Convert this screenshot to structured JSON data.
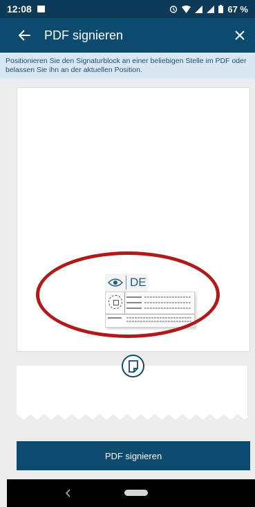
{
  "status_bar": {
    "time": "12:08",
    "battery_percent": "67 %",
    "icons": [
      "image-icon",
      "alarm-icon",
      "wifi-icon",
      "signal-icon",
      "signal-icon",
      "battery-icon"
    ]
  },
  "app_bar": {
    "title": "PDF signieren",
    "back_icon": "arrow-left-icon",
    "close_icon": "close-icon"
  },
  "info": {
    "text": "Positionieren Sie den Signaturblock an einer beliebigen Stelle im PDF oder belassen Sie ihn an der aktuellen Position."
  },
  "signature_block": {
    "logo_text": "DE",
    "logo_icon": "eye-icon"
  },
  "page_indicator_icon": "document-page-icon",
  "action": {
    "sign_label": "PDF signieren"
  },
  "colors": {
    "status_bar": "#0d3a59",
    "app_bar": "#0d4a6f",
    "banner_bg": "#d9e7f2",
    "highlight": "#b11a1a"
  }
}
